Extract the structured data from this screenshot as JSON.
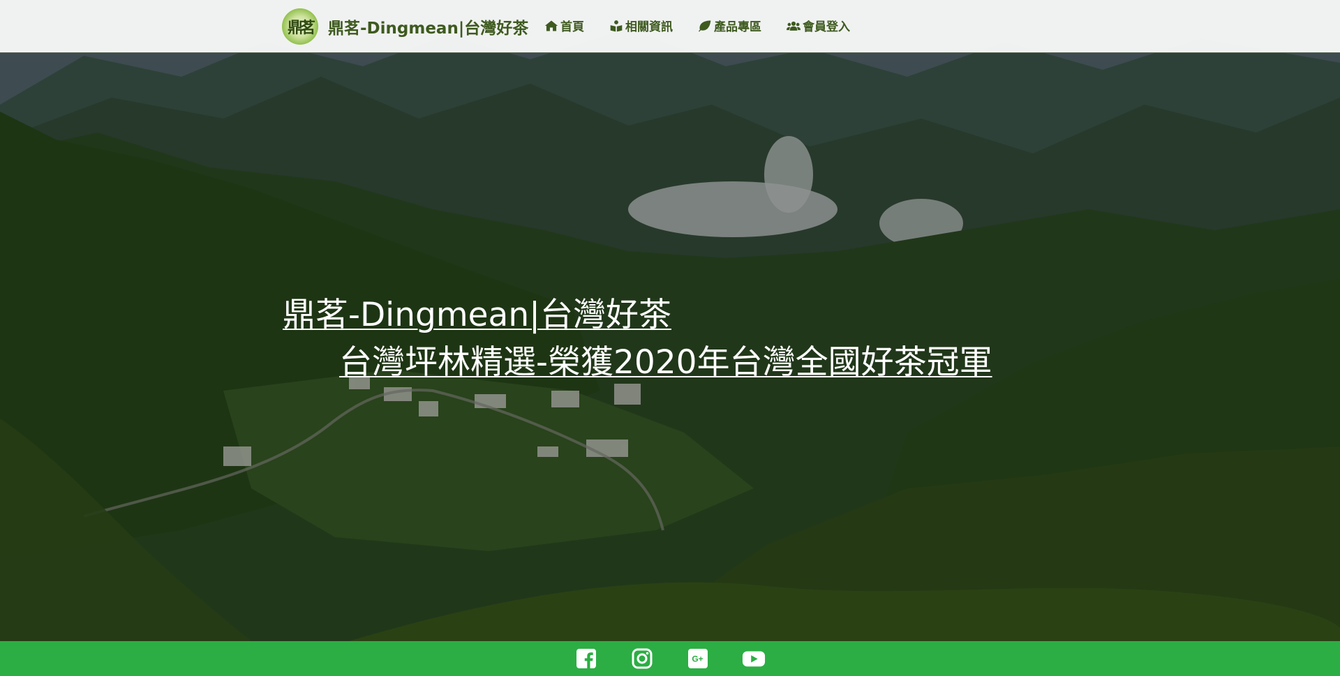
{
  "brand": {
    "logo_text": "鼎茗",
    "name": "鼎茗-Dingmean|台灣好茶"
  },
  "nav": {
    "items": [
      {
        "label": "首頁",
        "icon": "home-icon"
      },
      {
        "label": "相關資訊",
        "icon": "book-reader-icon"
      },
      {
        "label": "產品專區",
        "icon": "leaf-icon"
      },
      {
        "label": "會員登入",
        "icon": "users-icon"
      }
    ]
  },
  "hero": {
    "title": "鼎茗-Dingmean|台灣好茶",
    "subtitle": "台灣坪林精選-榮獲2020年台灣全國好茶冠軍"
  },
  "footer": {
    "social": [
      {
        "icon": "facebook-icon"
      },
      {
        "icon": "instagram-icon"
      },
      {
        "icon": "google-plus-icon"
      },
      {
        "icon": "youtube-icon"
      }
    ]
  },
  "colors": {
    "brand_green": "#3e5a1f",
    "footer_green": "#2cae44",
    "navbar_bg": "#f8f9f8"
  }
}
